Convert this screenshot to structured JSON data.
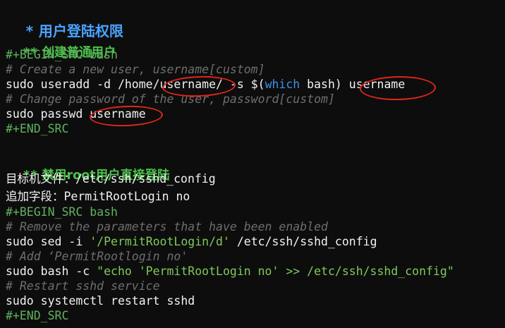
{
  "heading": {
    "star": "*",
    "title": "用户登陆权限"
  },
  "section1": {
    "heading_stars": "**",
    "heading_title": "创建普通用户",
    "begin_src": "#+BEGIN_SRC bash",
    "comment1": "# Create a new user, username[custom]",
    "cmd1_part1": "sudo useradd -d /home/",
    "cmd1_username1": "username/",
    "cmd1_part2": " -s $(",
    "cmd1_which": "which",
    "cmd1_part3": " bash) ",
    "cmd1_username2": "username",
    "comment2": "# Change password of the user, password[custom]",
    "cmd2_part1": "sudo passwd ",
    "cmd2_username": "username",
    "end_src": "#+END_SRC"
  },
  "section2": {
    "heading_stars": "**",
    "heading_title": "禁用root用户直接登陆",
    "target_label": "目标机文件：",
    "target_value": "/etc/ssh/sshd_config",
    "append_label": "追加字段：",
    "append_value": "PermitRootLogin no",
    "begin_src": "#+BEGIN_SRC bash",
    "comment1": "# Remove the parameters that have been enabled",
    "cmd1_part1": "sudo sed -i ",
    "cmd1_str": "'/PermitRootLogin/d'",
    "cmd1_part2": " /etc/ssh/sshd_config",
    "comment2": "# Add ‘PermitRootlogin no'",
    "cmd2_part1": "sudo bash -c ",
    "cmd2_str": "\"echo 'PermitRootLogin no' >> /etc/ssh/sshd_config\"",
    "comment3": "# Restart sshd service",
    "cmd3": "sudo systemctl restart sshd",
    "end_src": "#+END_SRC"
  },
  "annotation_color": "#e0261b"
}
